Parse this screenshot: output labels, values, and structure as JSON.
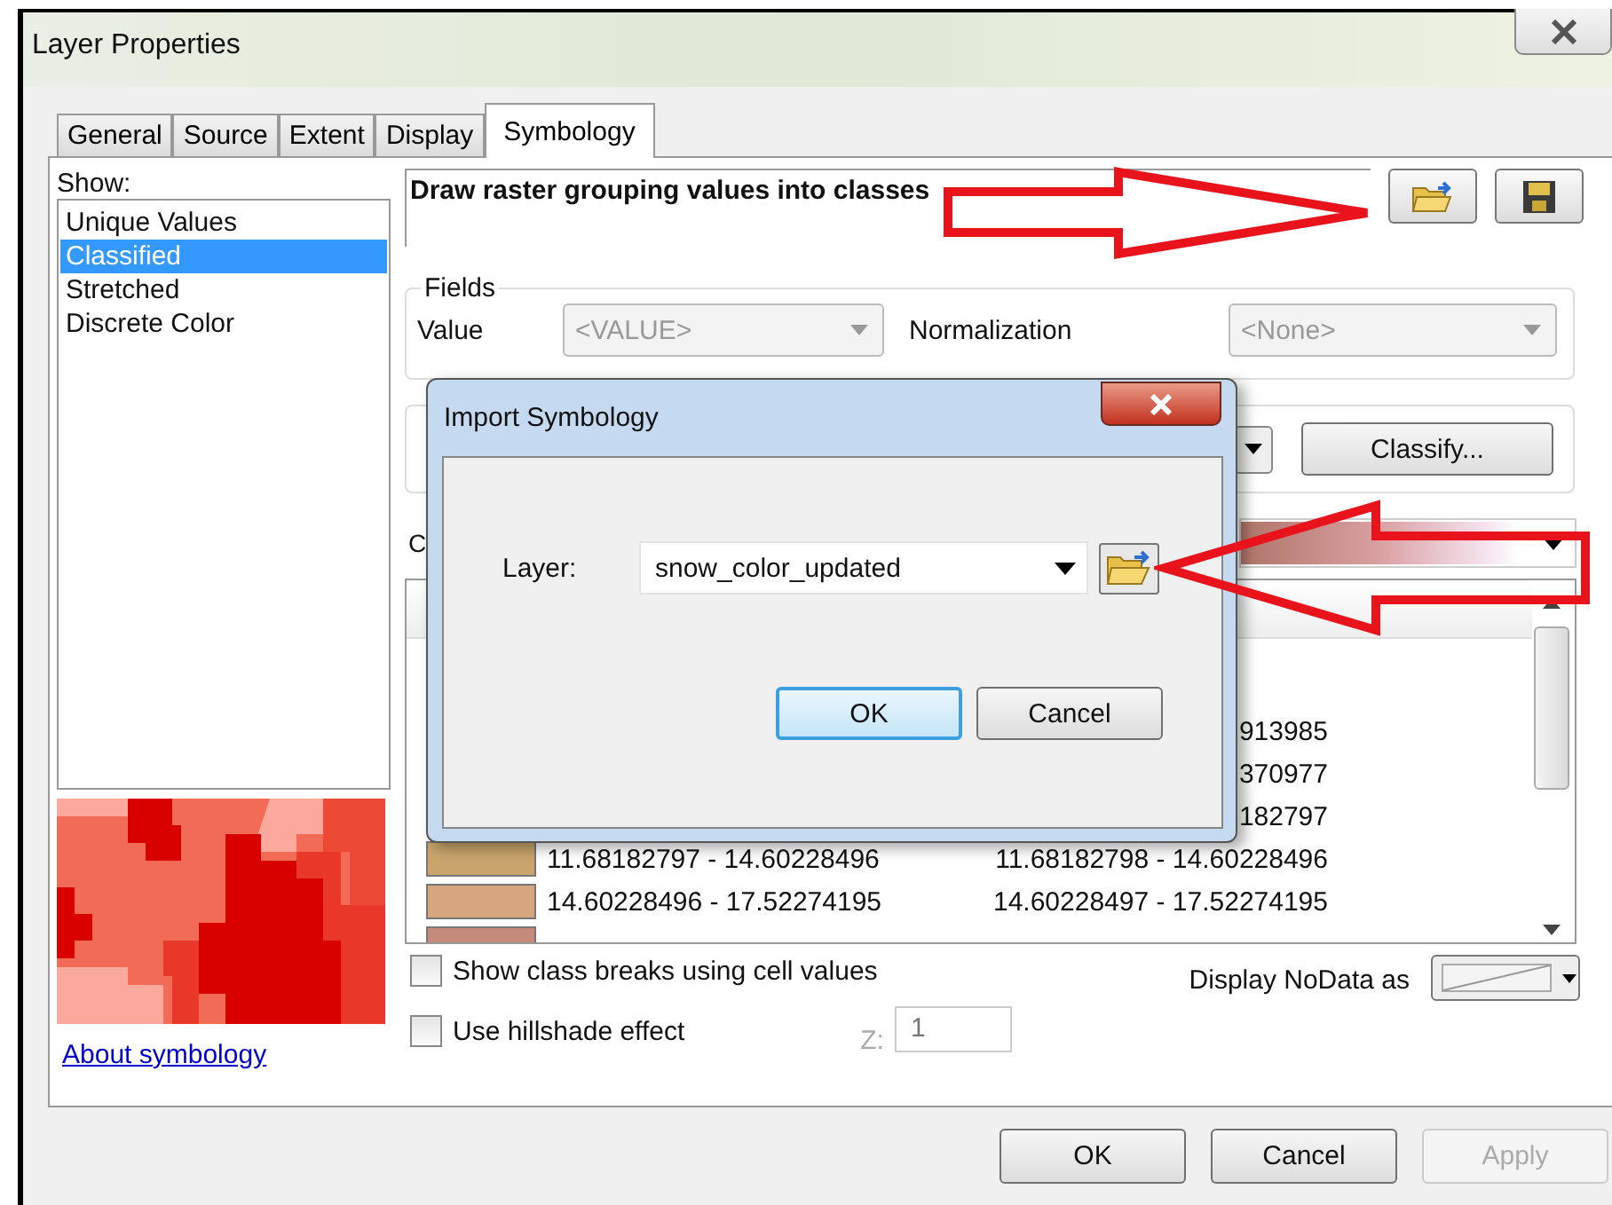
{
  "window": {
    "title": "Layer Properties"
  },
  "tabs": [
    {
      "label": "General",
      "selected": false
    },
    {
      "label": "Source",
      "selected": false
    },
    {
      "label": "Extent",
      "selected": false
    },
    {
      "label": "Display",
      "selected": false
    },
    {
      "label": "Symbology",
      "selected": true
    }
  ],
  "show": {
    "label": "Show:",
    "items": [
      {
        "label": "Unique Values",
        "selected": false
      },
      {
        "label": "Classified",
        "selected": true
      },
      {
        "label": "Stretched",
        "selected": false
      },
      {
        "label": "Discrete Color",
        "selected": false
      }
    ]
  },
  "about_link": "About symbology",
  "description": "Draw raster grouping values into classes",
  "fields": {
    "legend": "Fields",
    "value_label": "Value",
    "value": {
      "text": "<VALUE>",
      "disabled": true
    },
    "normalization_label": "Normalization",
    "normalization": {
      "text": "<None>",
      "disabled": true
    }
  },
  "classify_button": "Classify...",
  "color_ramp": {
    "label": "C"
  },
  "classes": [
    {
      "column_2": "913985"
    },
    {
      "column_2": "370977"
    },
    {
      "column_2": "182797"
    },
    {
      "color": "#c9a56c",
      "column_1": "11.68182797 - 14.60228496",
      "column_2": "11.68182798 - 14.60228496"
    },
    {
      "color": "#d6a67e",
      "column_1": "14.60228496 - 17.52274195",
      "column_2": "14.60228497 - 17.52274195"
    },
    {
      "color": "#c48a7a"
    }
  ],
  "checkboxes": [
    {
      "label": "Show class breaks using cell values",
      "checked": false
    },
    {
      "label": "Use hillshade effect",
      "checked": false
    }
  ],
  "z": {
    "label": "Z:",
    "value": "1",
    "disabled": true
  },
  "nodata_label": "Display NoData as",
  "buttons": [
    {
      "label": "OK",
      "disabled": false
    },
    {
      "label": "Cancel",
      "disabled": false
    },
    {
      "label": "Apply",
      "disabled": true
    }
  ],
  "import_dialog": {
    "title": "Import Symbology",
    "layer_label": "Layer:",
    "layer": "snow_color_updated",
    "buttons": [
      {
        "label": "OK",
        "focused": true
      },
      {
        "label": "Cancel",
        "focused": false
      }
    ]
  }
}
